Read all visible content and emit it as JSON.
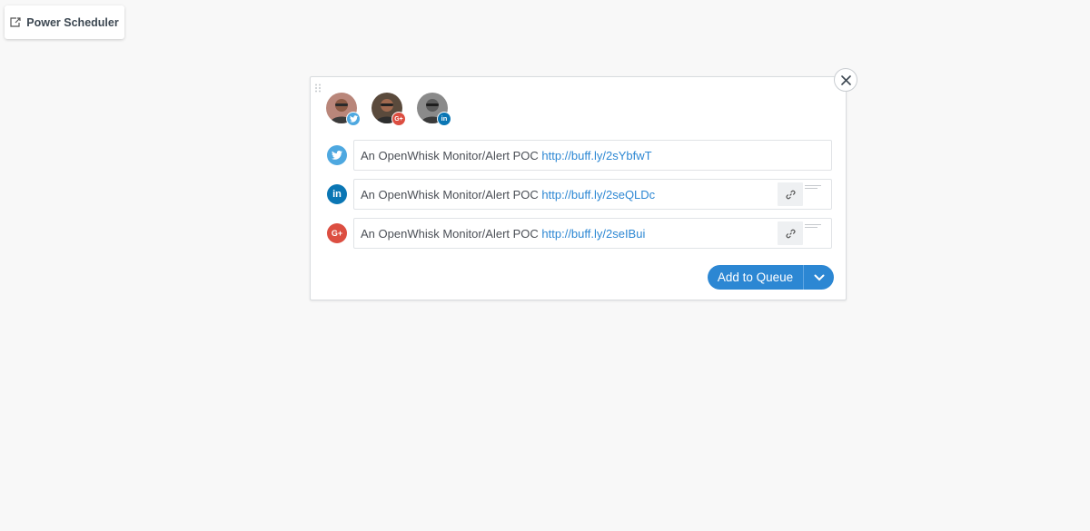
{
  "toolbar": {
    "power_scheduler_label": "Power Scheduler",
    "power_scheduler_icon": "external-share-icon"
  },
  "composer": {
    "avatars": [
      {
        "network": "twitter",
        "badge_icon": "twitter-icon",
        "badge_color": "#4ea8e0"
      },
      {
        "network": "google-plus",
        "badge_icon": "google-plus-icon",
        "badge_color": "#dc4e41"
      },
      {
        "network": "linkedin",
        "badge_icon": "linkedin-icon",
        "badge_color": "#0a76b4"
      }
    ],
    "rows": [
      {
        "network": "twitter",
        "icon": "twitter-icon",
        "icon_color": "#4ea8e0",
        "text": "An OpenWhisk Monitor/Alert POC ",
        "link": "http://buff.ly/2sYbfwT",
        "has_attachment": false
      },
      {
        "network": "linkedin",
        "icon": "linkedin-icon",
        "icon_color": "#0a76b4",
        "text": "An OpenWhisk Monitor/Alert POC ",
        "link": "http://buff.ly/2seQLDc",
        "has_attachment": true
      },
      {
        "network": "google-plus",
        "icon": "google-plus-icon",
        "icon_color": "#dc4e41",
        "text": "An OpenWhisk Monitor/Alert POC ",
        "link": "http://buff.ly/2seIBui",
        "has_attachment": true
      }
    ],
    "add_to_queue_label": "Add to Queue",
    "accent_color": "#2c87d3"
  }
}
